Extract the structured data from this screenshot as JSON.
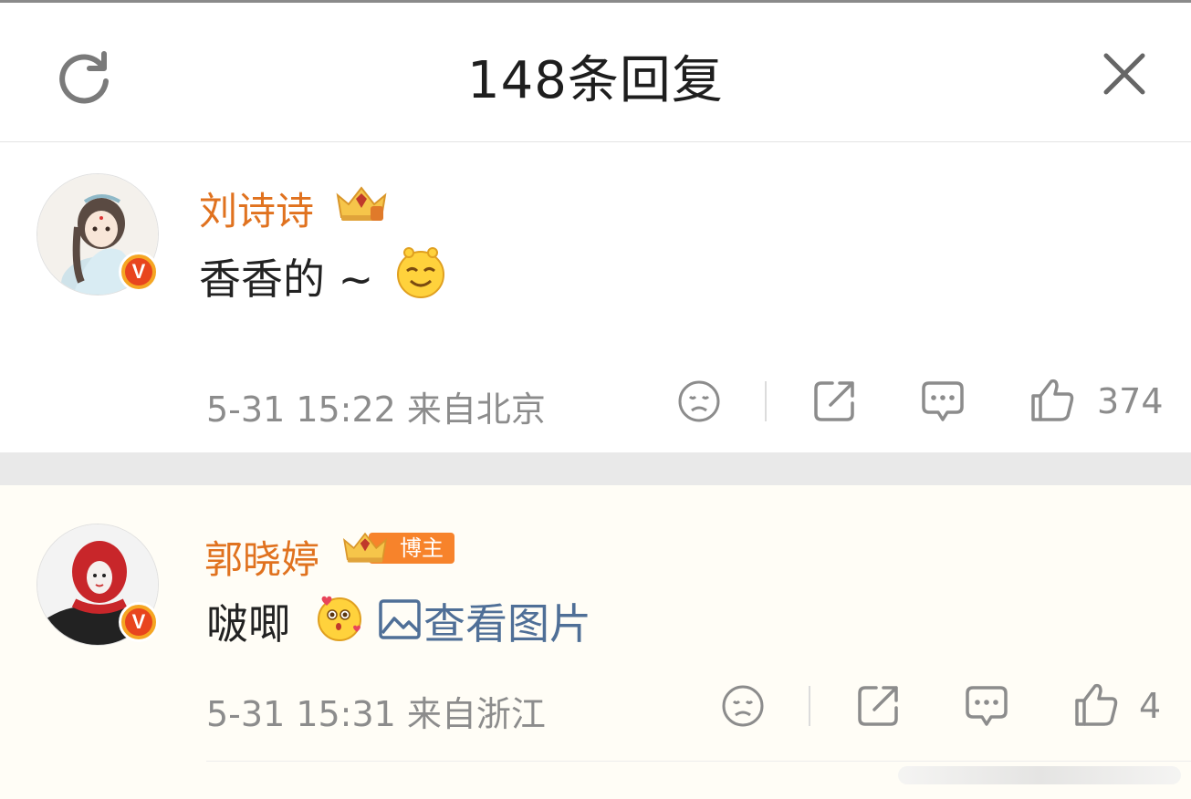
{
  "header": {
    "title": "148条回复",
    "refresh_icon": "refresh-icon",
    "close_icon": "close-icon"
  },
  "comments": [
    {
      "username": "刘诗诗",
      "badge_icon": "crown-badge-icon",
      "verified_icon": "verified-v-icon",
      "text": "香香的 ~",
      "emoji_icon": "smiling-face-emoji",
      "meta": "5-31 15:22  来自北京",
      "likes": "374"
    },
    {
      "username": "郭晓婷",
      "badge_icon": "crown-badge-icon",
      "badge_label": "博主",
      "verified_icon": "verified-v-icon",
      "text": "啵唧",
      "emoji_icon": "kiss-heart-emoji",
      "link_text": "查看图片",
      "meta": "5-31 15:31  来自浙江",
      "likes": "4"
    }
  ],
  "verified_letter": "V",
  "colors": {
    "username": "#e0721f",
    "link": "#4f6f97",
    "meta": "#8c8c8c",
    "second_comment_bg": "#fffdf6"
  }
}
